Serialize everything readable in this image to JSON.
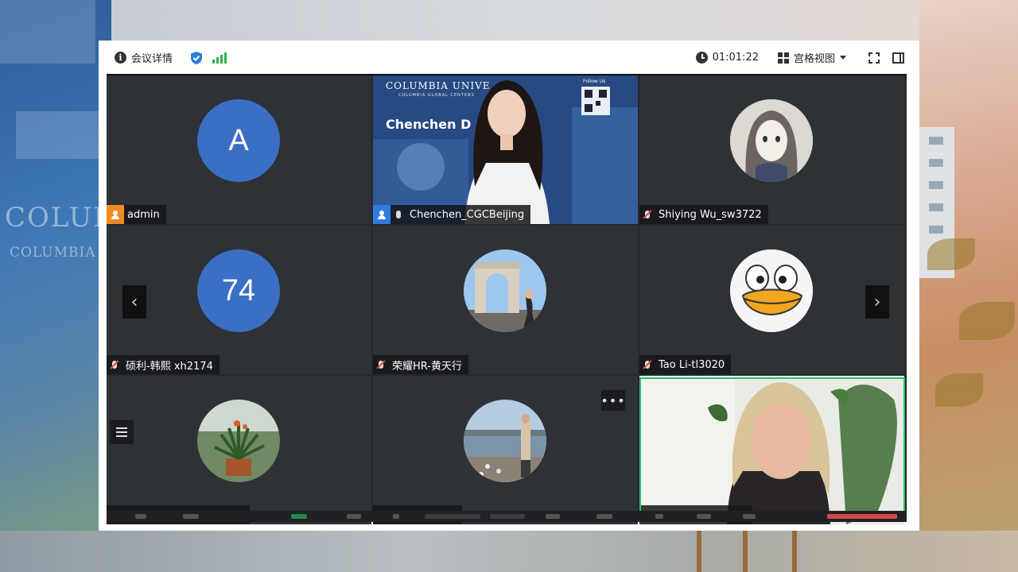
{
  "topbar": {
    "meeting_info_label": "会议详情",
    "timer": "01:01:22",
    "view_label": "宫格视图"
  },
  "backdrop": {
    "word1": "COLUM",
    "word2": "COLUMBIA"
  },
  "participants": [
    {
      "name": "admin",
      "avatar_type": "letter",
      "avatar_text": "A",
      "role": "host",
      "mic": "none"
    },
    {
      "name": "Chenchen_CGCBeijing",
      "avatar_type": "video",
      "role": "cohost",
      "mic": "on"
    },
    {
      "name": "Shiying Wu_sw3722",
      "avatar_type": "photo",
      "role": "participant",
      "mic": "muted"
    },
    {
      "name": "硕利-韩熙 xh2174",
      "avatar_type": "letter",
      "avatar_text": "74",
      "role": "participant",
      "mic": "muted"
    },
    {
      "name": "荣耀HR-黄天行",
      "avatar_type": "photo",
      "role": "participant",
      "mic": "muted"
    },
    {
      "name": "Tao Li-tl3020",
      "avatar_type": "photo",
      "role": "participant",
      "mic": "muted"
    },
    {
      "name": "",
      "avatar_type": "photo",
      "role": "participant",
      "mic": "muted"
    },
    {
      "name": "",
      "avatar_type": "photo",
      "role": "participant",
      "mic": "muted"
    },
    {
      "name": "",
      "avatar_type": "video",
      "role": "participant",
      "mic": "on",
      "active_speaker": true
    }
  ],
  "video_overlay": {
    "university": "COLUMBIA UNIVE",
    "subtitle": "COLUMBIA GLOBAL CENTERS",
    "speaker_banner": "Chenchen D",
    "follow_label": "Follow Us"
  },
  "colors": {
    "accent_green": "#2bc06b",
    "host_orange": "#f08a24",
    "cohost_blue": "#2f7de1",
    "avatar_blue": "#3a6fc4",
    "tile_bg": "#2e3136"
  },
  "icons": {
    "prev": "chevron-left-icon",
    "next": "chevron-right-icon",
    "more": "more-icon",
    "list": "menu-icon"
  }
}
